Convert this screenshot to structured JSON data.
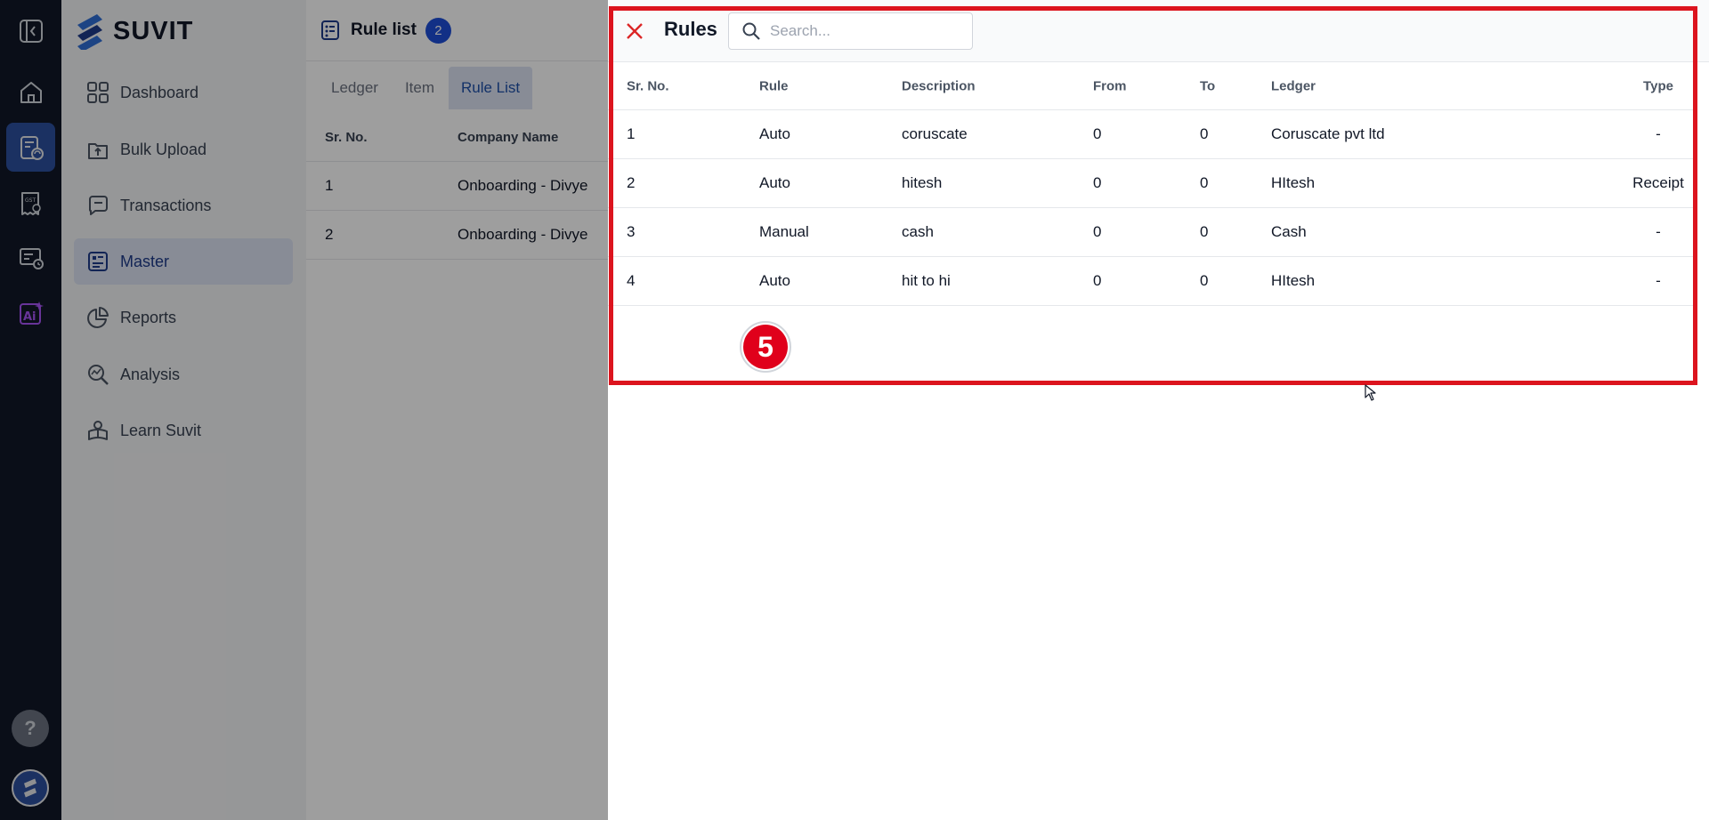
{
  "brand": {
    "name": "SUVIT"
  },
  "sidebar": {
    "items": [
      {
        "label": "Dashboard",
        "icon": "grid-icon"
      },
      {
        "label": "Bulk Upload",
        "icon": "upload-icon"
      },
      {
        "label": "Transactions",
        "icon": "chat-icon"
      },
      {
        "label": "Master",
        "icon": "master-icon",
        "active": true
      },
      {
        "label": "Reports",
        "icon": "pie-chart-icon"
      },
      {
        "label": "Analysis",
        "icon": "analysis-icon"
      },
      {
        "label": "Learn Suvit",
        "icon": "learn-icon"
      }
    ]
  },
  "rail": {
    "help_label": "?"
  },
  "main": {
    "title": "Rule list",
    "count": "2",
    "tabs": [
      {
        "label": "Ledger"
      },
      {
        "label": "Item"
      },
      {
        "label": "Rule List",
        "active": true
      }
    ],
    "table": {
      "headers": [
        "Sr. No.",
        "Company Name"
      ],
      "rows": [
        [
          "1",
          "Onboarding - Divye"
        ],
        [
          "2",
          "Onboarding - Divye"
        ]
      ]
    }
  },
  "drawer": {
    "title": "Rules",
    "search_placeholder": "Search...",
    "headers": {
      "sr": "Sr. No.",
      "rule": "Rule",
      "description": "Description",
      "from": "From",
      "to": "To",
      "ledger": "Ledger",
      "type": "Type"
    },
    "rows": [
      {
        "sr": "1",
        "rule": "Auto",
        "description": "coruscate",
        "from": "0",
        "to": "0",
        "ledger": "Coruscate pvt ltd",
        "type": "-"
      },
      {
        "sr": "2",
        "rule": "Auto",
        "description": "hitesh",
        "from": "0",
        "to": "0",
        "ledger": "HItesh",
        "type": "Receipt"
      },
      {
        "sr": "3",
        "rule": "Manual",
        "description": "cash",
        "from": "0",
        "to": "0",
        "ledger": "Cash",
        "type": "-"
      },
      {
        "sr": "4",
        "rule": "Auto",
        "description": "hit to hi",
        "from": "0",
        "to": "0",
        "ledger": "HItesh",
        "type": "-"
      }
    ]
  },
  "annotation": {
    "step": "5",
    "highlight_color": "#dc141e"
  }
}
